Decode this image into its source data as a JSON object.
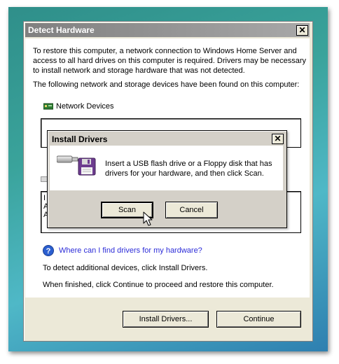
{
  "main_window": {
    "title": "Detect Hardware",
    "intro_line1": "To restore this computer, a network connection to Windows Home Server and",
    "intro_line2": "access to all hard drives on this computer is required. Drivers may be necessary",
    "intro_line3": "to install network and storage hardware that was not detected.",
    "devices_found": "The following network and storage devices have been found on this computer:",
    "network_devices_label": "Network Devices",
    "storage_list_items": [
      "I",
      "A",
      "A"
    ],
    "help_link": "Where can I find drivers for my hardware?",
    "detect_text": "To detect additional devices, click Install Drivers.",
    "finish_text": "When finished, click Continue to proceed and restore this computer.",
    "install_drivers_button": "Install Drivers...",
    "continue_button": "Continue",
    "close_glyph": "✕"
  },
  "dialog": {
    "title": "Install Drivers",
    "message_line1": "Insert a USB flash drive or a Floppy disk that has",
    "message_line2": "drivers for your hardware, and then click Scan.",
    "scan_button": "Scan",
    "cancel_button": "Cancel",
    "close_glyph": "✕"
  },
  "icons": [
    "close-icon",
    "network-card-icon",
    "usb-drive-icon",
    "floppy-disk-icon",
    "help-icon",
    "mouse-cursor-icon"
  ]
}
